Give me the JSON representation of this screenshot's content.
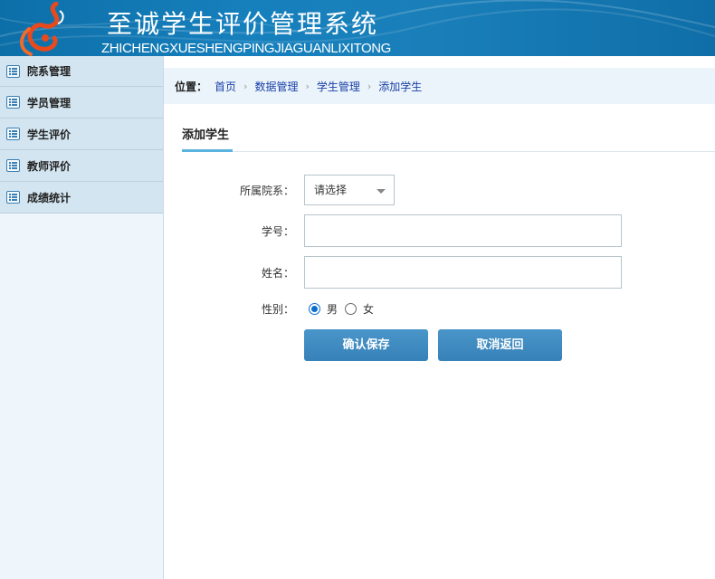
{
  "header": {
    "title": "至诚学生评价管理系统",
    "subtitle": "ZHICHENGXUESHENGPINGJIAGUANLIXITONG",
    "logo_icon": "flame-logo-icon",
    "colors": {
      "bar": "#1680bd",
      "logo": "#e84a1e"
    }
  },
  "sidebar": {
    "items": [
      {
        "label": "院系管理",
        "icon": "list-icon"
      },
      {
        "label": "学员管理",
        "icon": "list-icon"
      },
      {
        "label": "学生评价",
        "icon": "list-icon"
      },
      {
        "label": "教师评价",
        "icon": "list-icon"
      },
      {
        "label": "成绩统计",
        "icon": "list-icon"
      }
    ]
  },
  "breadcrumb": {
    "prefix": "位置：",
    "items": [
      "首页",
      "数据管理",
      "学生管理",
      "添加学生"
    ],
    "separator": "›"
  },
  "section": {
    "title": "添加学生"
  },
  "form": {
    "department_label": "所属院系：",
    "department_value": "请选择",
    "student_no_label": "学号：",
    "student_no_value": "",
    "name_label": "姓名：",
    "name_value": "",
    "gender_label": "性别：",
    "gender_options": [
      "男",
      "女"
    ],
    "gender_selected": "男",
    "save_button": "确认保存",
    "cancel_button": "取消返回"
  }
}
